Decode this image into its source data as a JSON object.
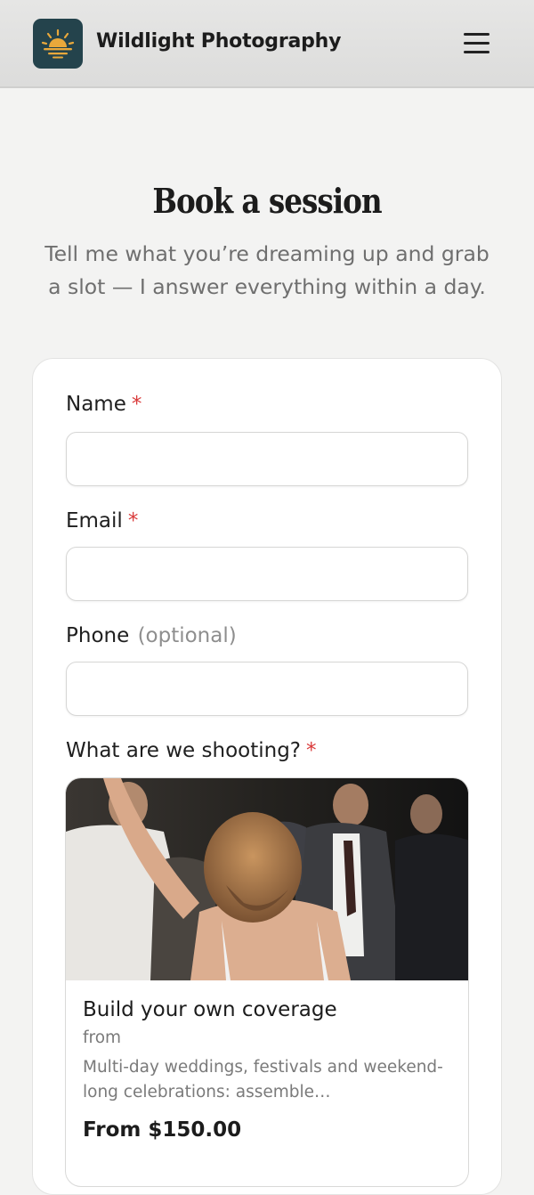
{
  "header": {
    "brand": "Wildlight Photography",
    "logo_icon": "sunrise-icon",
    "menu_icon": "hamburger-menu-icon",
    "colors": {
      "logo_bg": "#24434c",
      "sun": "#e9a83b"
    }
  },
  "hero": {
    "title": "Book a session",
    "subtitle": "Tell me what you’re dreaming up and grab a slot — I answer everything within a day."
  },
  "form": {
    "name": {
      "label": "Name",
      "required_mark": "*",
      "value": ""
    },
    "email": {
      "label": "Email",
      "required_mark": "*",
      "value": ""
    },
    "phone": {
      "label": "Phone",
      "optional_note": "(optional)",
      "value": ""
    },
    "shoot_type": {
      "label": "What are we shooting?",
      "required_mark": "*",
      "options": [
        {
          "title": "Build your own coverage",
          "from_label": "from",
          "description": "Multi-day weddings, festivals and weekend-long celebrations: assemble…",
          "price": "From $150.00",
          "image": "photo of a woman dancing at a party"
        }
      ]
    }
  },
  "colors": {
    "required": "#d93a3a",
    "page_bg": "#f3f3f2"
  }
}
